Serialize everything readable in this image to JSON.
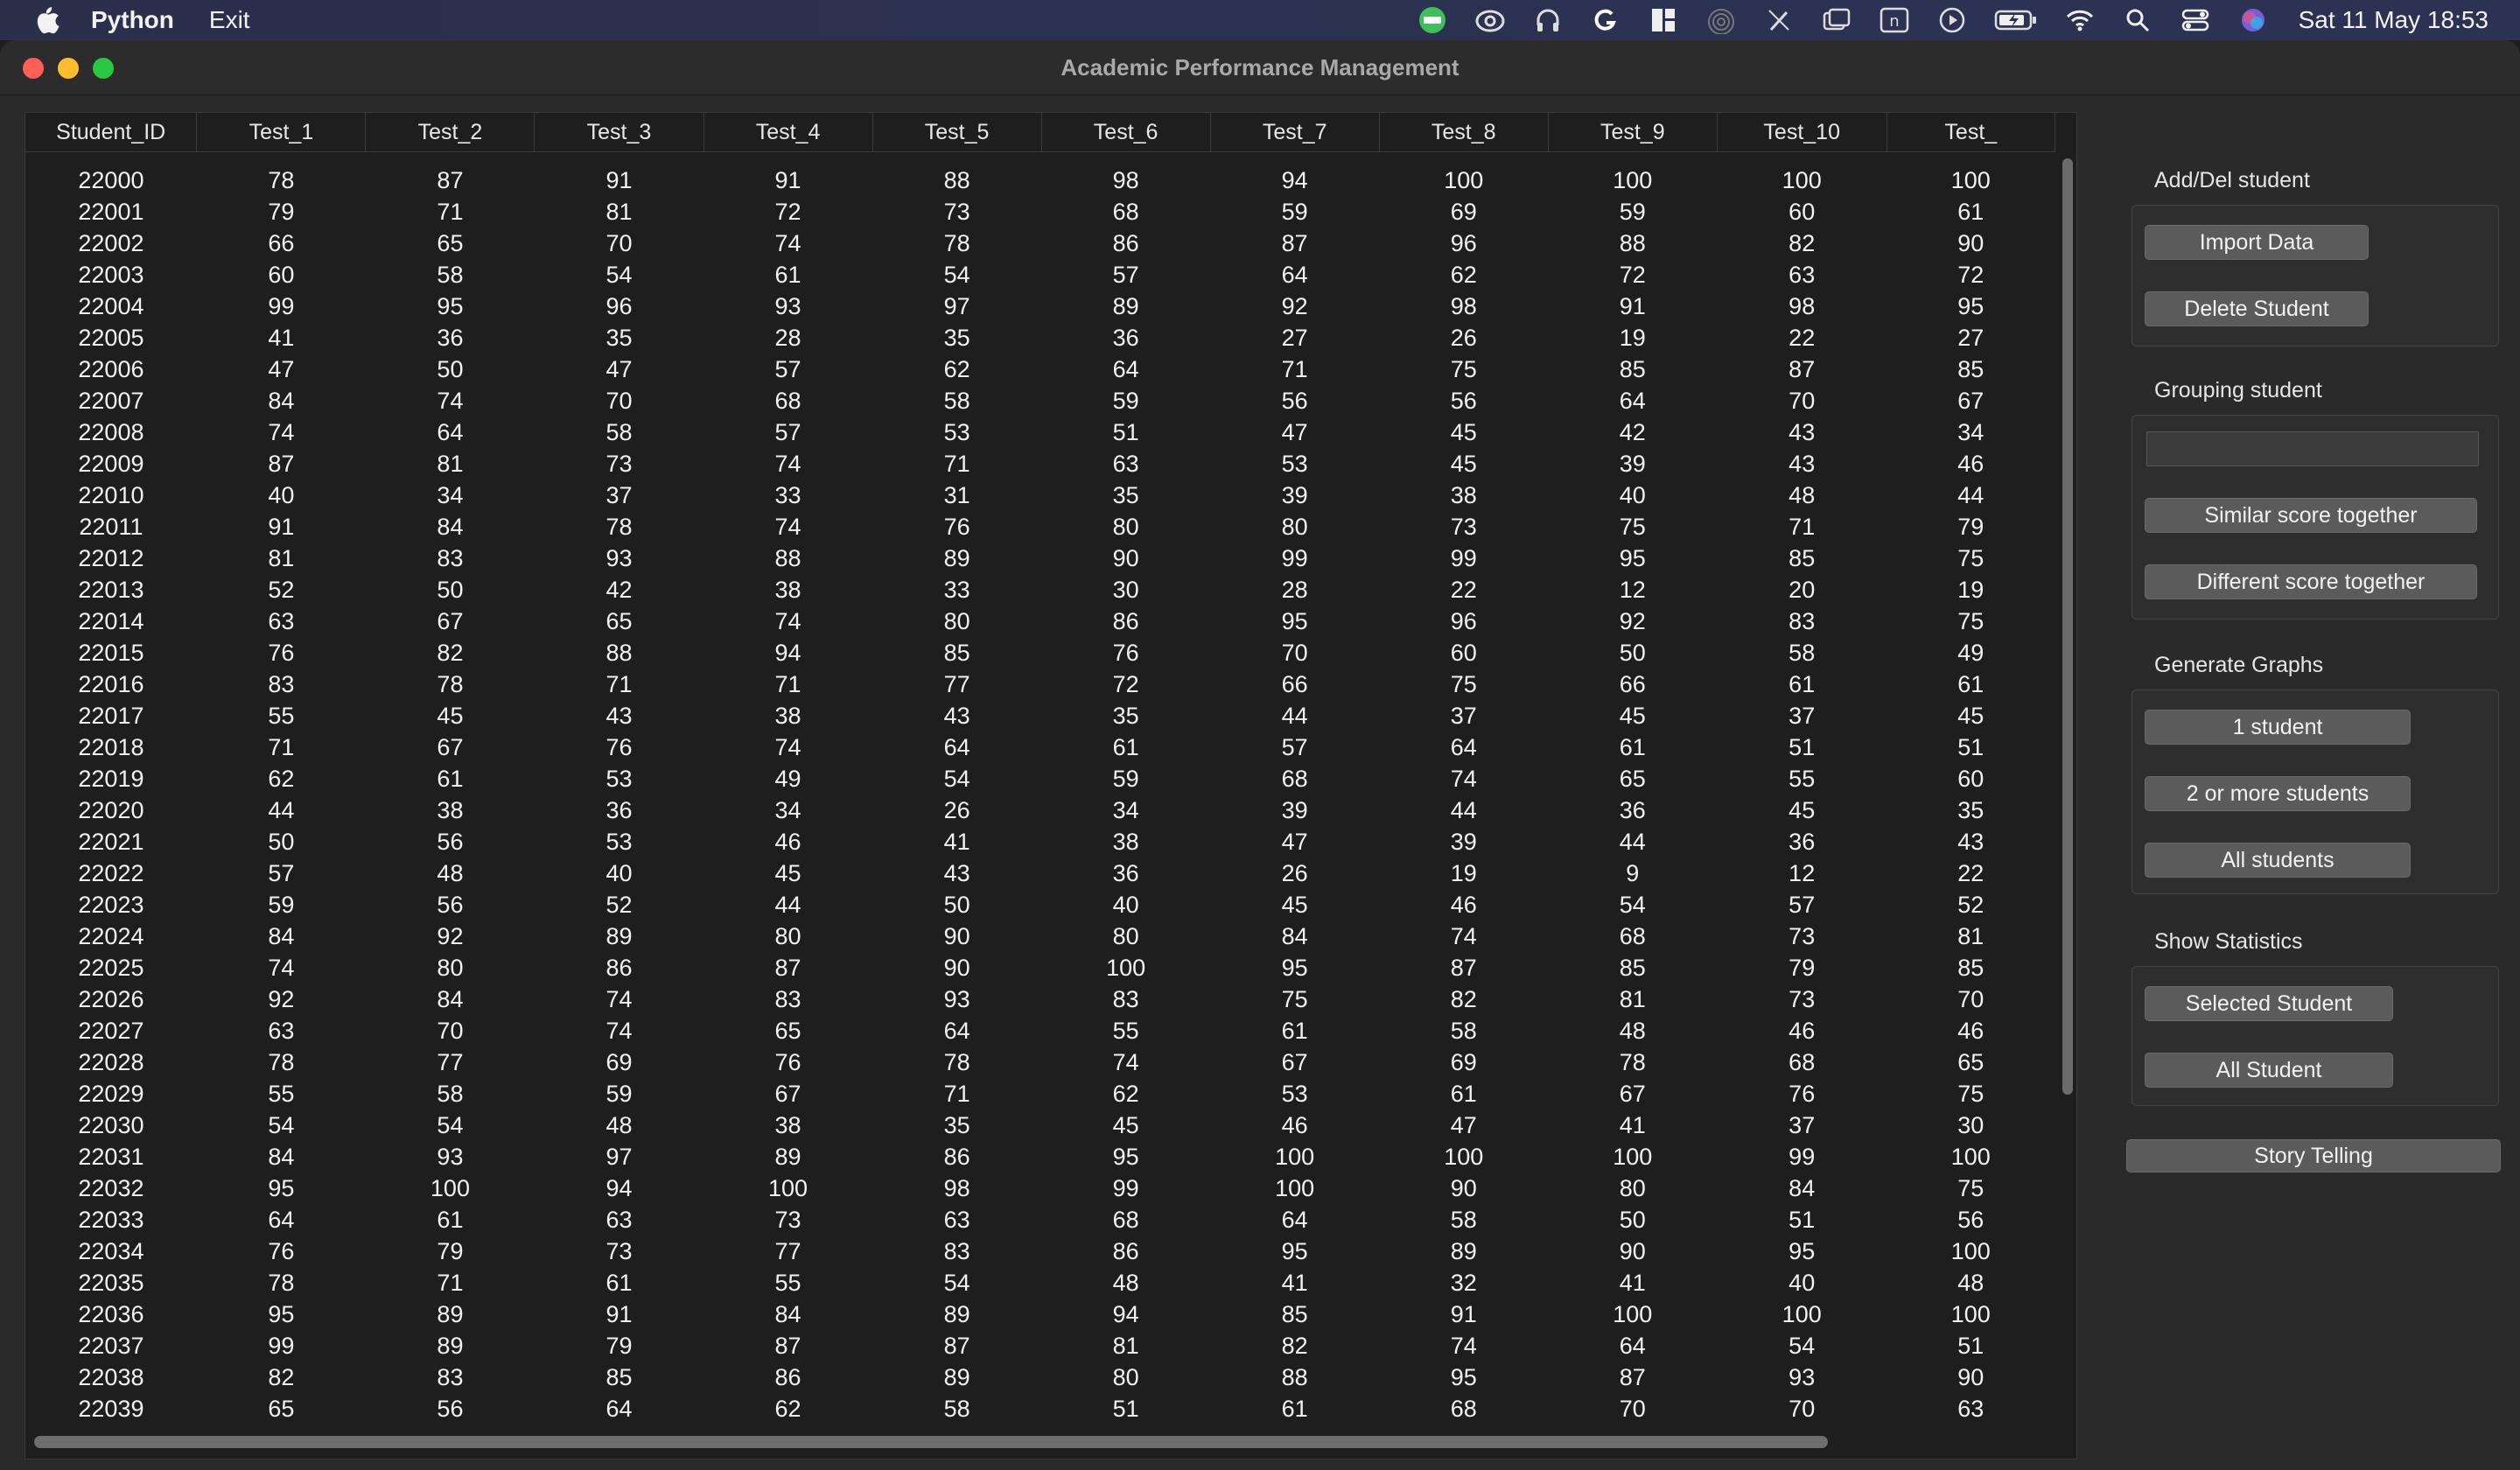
{
  "menubar": {
    "app_name": "Python",
    "menu_items": [
      "Exit"
    ],
    "status_icons": [
      "line-app-icon",
      "creative-cloud-icon",
      "headphones-icon",
      "grammarly-icon",
      "window-layout-icon",
      "airdrop-icon",
      "pen-off-icon",
      "screen-mirror-icon",
      "n-app-icon",
      "play-icon",
      "battery-charging-icon",
      "wifi-icon",
      "spotlight-search-icon",
      "control-center-icon",
      "siri-icon"
    ],
    "clock": "Sat 11 May  18:53"
  },
  "window": {
    "title": "Academic Performance Management"
  },
  "table": {
    "columns": [
      "Student_ID",
      "Test_1",
      "Test_2",
      "Test_3",
      "Test_4",
      "Test_5",
      "Test_6",
      "Test_7",
      "Test_8",
      "Test_9",
      "Test_10",
      "Test_"
    ],
    "rows": [
      [
        "22000",
        "78",
        "87",
        "91",
        "91",
        "88",
        "98",
        "94",
        "100",
        "100",
        "100",
        "100"
      ],
      [
        "22001",
        "79",
        "71",
        "81",
        "72",
        "73",
        "68",
        "59",
        "69",
        "59",
        "60",
        "61"
      ],
      [
        "22002",
        "66",
        "65",
        "70",
        "74",
        "78",
        "86",
        "87",
        "96",
        "88",
        "82",
        "90"
      ],
      [
        "22003",
        "60",
        "58",
        "54",
        "61",
        "54",
        "57",
        "64",
        "62",
        "72",
        "63",
        "72"
      ],
      [
        "22004",
        "99",
        "95",
        "96",
        "93",
        "97",
        "89",
        "92",
        "98",
        "91",
        "98",
        "95"
      ],
      [
        "22005",
        "41",
        "36",
        "35",
        "28",
        "35",
        "36",
        "27",
        "26",
        "19",
        "22",
        "27"
      ],
      [
        "22006",
        "47",
        "50",
        "47",
        "57",
        "62",
        "64",
        "71",
        "75",
        "85",
        "87",
        "85"
      ],
      [
        "22007",
        "84",
        "74",
        "70",
        "68",
        "58",
        "59",
        "56",
        "56",
        "64",
        "70",
        "67"
      ],
      [
        "22008",
        "74",
        "64",
        "58",
        "57",
        "53",
        "51",
        "47",
        "45",
        "42",
        "43",
        "34"
      ],
      [
        "22009",
        "87",
        "81",
        "73",
        "74",
        "71",
        "63",
        "53",
        "45",
        "39",
        "43",
        "46"
      ],
      [
        "22010",
        "40",
        "34",
        "37",
        "33",
        "31",
        "35",
        "39",
        "38",
        "40",
        "48",
        "44"
      ],
      [
        "22011",
        "91",
        "84",
        "78",
        "74",
        "76",
        "80",
        "80",
        "73",
        "75",
        "71",
        "79"
      ],
      [
        "22012",
        "81",
        "83",
        "93",
        "88",
        "89",
        "90",
        "99",
        "99",
        "95",
        "85",
        "75"
      ],
      [
        "22013",
        "52",
        "50",
        "42",
        "38",
        "33",
        "30",
        "28",
        "22",
        "12",
        "20",
        "19"
      ],
      [
        "22014",
        "63",
        "67",
        "65",
        "74",
        "80",
        "86",
        "95",
        "96",
        "92",
        "83",
        "75"
      ],
      [
        "22015",
        "76",
        "82",
        "88",
        "94",
        "85",
        "76",
        "70",
        "60",
        "50",
        "58",
        "49"
      ],
      [
        "22016",
        "83",
        "78",
        "71",
        "71",
        "77",
        "72",
        "66",
        "75",
        "66",
        "61",
        "61"
      ],
      [
        "22017",
        "55",
        "45",
        "43",
        "38",
        "43",
        "35",
        "44",
        "37",
        "45",
        "37",
        "45"
      ],
      [
        "22018",
        "71",
        "67",
        "76",
        "74",
        "64",
        "61",
        "57",
        "64",
        "61",
        "51",
        "51"
      ],
      [
        "22019",
        "62",
        "61",
        "53",
        "49",
        "54",
        "59",
        "68",
        "74",
        "65",
        "55",
        "60"
      ],
      [
        "22020",
        "44",
        "38",
        "36",
        "34",
        "26",
        "34",
        "39",
        "44",
        "36",
        "45",
        "35"
      ],
      [
        "22021",
        "50",
        "56",
        "53",
        "46",
        "41",
        "38",
        "47",
        "39",
        "44",
        "36",
        "43"
      ],
      [
        "22022",
        "57",
        "48",
        "40",
        "45",
        "43",
        "36",
        "26",
        "19",
        "9",
        "12",
        "22"
      ],
      [
        "22023",
        "59",
        "56",
        "52",
        "44",
        "50",
        "40",
        "45",
        "46",
        "54",
        "57",
        "52"
      ],
      [
        "22024",
        "84",
        "92",
        "89",
        "80",
        "90",
        "80",
        "84",
        "74",
        "68",
        "73",
        "81"
      ],
      [
        "22025",
        "74",
        "80",
        "86",
        "87",
        "90",
        "100",
        "95",
        "87",
        "85",
        "79",
        "85"
      ],
      [
        "22026",
        "92",
        "84",
        "74",
        "83",
        "93",
        "83",
        "75",
        "82",
        "81",
        "73",
        "70"
      ],
      [
        "22027",
        "63",
        "70",
        "74",
        "65",
        "64",
        "55",
        "61",
        "58",
        "48",
        "46",
        "46"
      ],
      [
        "22028",
        "78",
        "77",
        "69",
        "76",
        "78",
        "74",
        "67",
        "69",
        "78",
        "68",
        "65"
      ],
      [
        "22029",
        "55",
        "58",
        "59",
        "67",
        "71",
        "62",
        "53",
        "61",
        "67",
        "76",
        "75"
      ],
      [
        "22030",
        "54",
        "54",
        "48",
        "38",
        "35",
        "45",
        "46",
        "47",
        "41",
        "37",
        "30"
      ],
      [
        "22031",
        "84",
        "93",
        "97",
        "89",
        "86",
        "95",
        "100",
        "100",
        "100",
        "99",
        "100"
      ],
      [
        "22032",
        "95",
        "100",
        "94",
        "100",
        "98",
        "99",
        "100",
        "90",
        "80",
        "84",
        "75"
      ],
      [
        "22033",
        "64",
        "61",
        "63",
        "73",
        "63",
        "68",
        "64",
        "58",
        "50",
        "51",
        "56"
      ],
      [
        "22034",
        "76",
        "79",
        "73",
        "77",
        "83",
        "86",
        "95",
        "89",
        "90",
        "95",
        "100"
      ],
      [
        "22035",
        "78",
        "71",
        "61",
        "55",
        "54",
        "48",
        "41",
        "32",
        "41",
        "40",
        "48"
      ],
      [
        "22036",
        "95",
        "89",
        "91",
        "84",
        "89",
        "94",
        "85",
        "91",
        "100",
        "100",
        "100"
      ],
      [
        "22037",
        "99",
        "89",
        "79",
        "87",
        "87",
        "81",
        "82",
        "74",
        "64",
        "54",
        "51"
      ],
      [
        "22038",
        "82",
        "83",
        "85",
        "86",
        "89",
        "80",
        "88",
        "95",
        "87",
        "93",
        "90"
      ],
      [
        "22039",
        "65",
        "56",
        "64",
        "62",
        "58",
        "51",
        "61",
        "68",
        "70",
        "70",
        "63"
      ]
    ]
  },
  "panel": {
    "add_del": {
      "title": "Add/Del student",
      "import_label": "Import Data",
      "delete_label": "Delete Student"
    },
    "grouping": {
      "title": "Grouping student",
      "input_value": "",
      "similar_label": "Similar score together",
      "different_label": "Different score together"
    },
    "graphs": {
      "title": "Generate Graphs",
      "one_label": "1 student",
      "two_label": "2 or more students",
      "all_label": "All students"
    },
    "stats": {
      "title": "Show Statistics",
      "selected_label": "Selected Student",
      "all_label": "All Student"
    },
    "story_label": "Story Telling"
  }
}
